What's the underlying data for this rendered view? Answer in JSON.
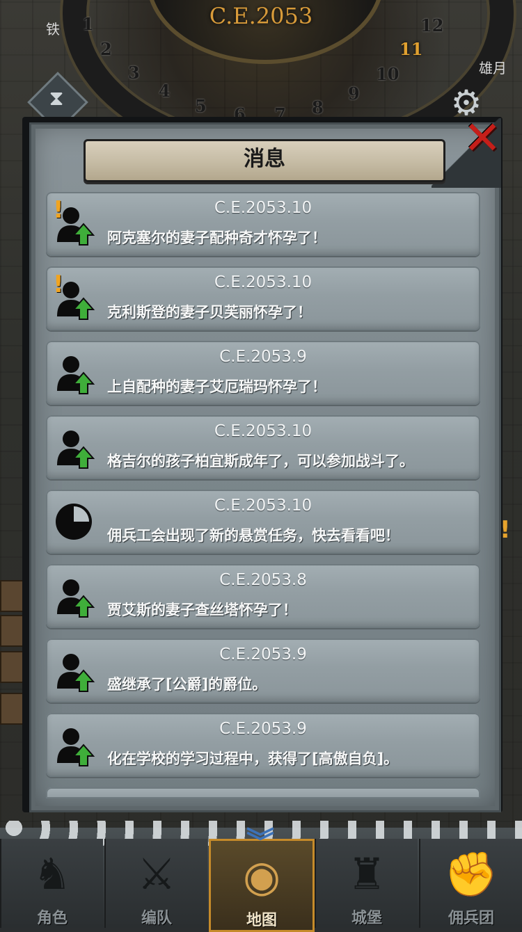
{
  "header": {
    "year": "C.E.2053",
    "dial_numbers": [
      "1",
      "2",
      "3",
      "4",
      "5",
      "6",
      "7",
      "8",
      "9",
      "10",
      "11",
      "12"
    ],
    "active_month": "11",
    "left_label": "铁",
    "right_label": "雄月"
  },
  "modal": {
    "title": "消息",
    "close_label": "×",
    "messages": [
      {
        "date": "C.E.2053.10",
        "text": "阿克塞尔的妻子配种奇才怀孕了！",
        "icon": "person-up-icon",
        "alert": true
      },
      {
        "date": "C.E.2053.10",
        "text": "克利斯登的妻子贝芙丽怀孕了！",
        "icon": "person-up-icon",
        "alert": true
      },
      {
        "date": "C.E.2053.9",
        "text": "上自配种的妻子艾厄瑞玛怀孕了！",
        "icon": "person-up-icon",
        "alert": false
      },
      {
        "date": "C.E.2053.10",
        "text": "格吉尔的孩子柏宜斯成年了，可以参加战斗了。",
        "icon": "person-up-icon",
        "alert": false
      },
      {
        "date": "C.E.2053.10",
        "text": "佣兵工会出现了新的悬赏任务，快去看看吧！",
        "icon": "clock-icon",
        "alert": false
      },
      {
        "date": "C.E.2053.8",
        "text": "贾艾斯的妻子查丝塔怀孕了！",
        "icon": "person-up-icon",
        "alert": false
      },
      {
        "date": "C.E.2053.9",
        "text": "盛继承了[公爵]的爵位。",
        "icon": "person-up-icon",
        "alert": false
      },
      {
        "date": "C.E.2053.9",
        "text": "化在学校的学习过程中，获得了[高傲自负]。",
        "icon": "person-up-icon",
        "alert": false
      }
    ],
    "alert_symbol": "!"
  },
  "nav": {
    "items": [
      {
        "label": "角色",
        "icon": "knight-icon",
        "glyph": "♞"
      },
      {
        "label": "编队",
        "icon": "team-icon",
        "glyph": "⚔"
      },
      {
        "label": "地图",
        "icon": "map-icon",
        "glyph": "◉"
      },
      {
        "label": "城堡",
        "icon": "castle-icon",
        "glyph": "♜"
      },
      {
        "label": "佣兵团",
        "icon": "mercenary-icon",
        "glyph": "✊"
      }
    ],
    "active_index": 2
  },
  "colors": {
    "accent_gold": "#d89b3a",
    "close_red": "#c51f1a",
    "arrow_green": "#3fae3a",
    "alert_orange": "#f0a421",
    "nav_active_border": "#c68b2a",
    "chevron_blue": "#3c72b8"
  }
}
